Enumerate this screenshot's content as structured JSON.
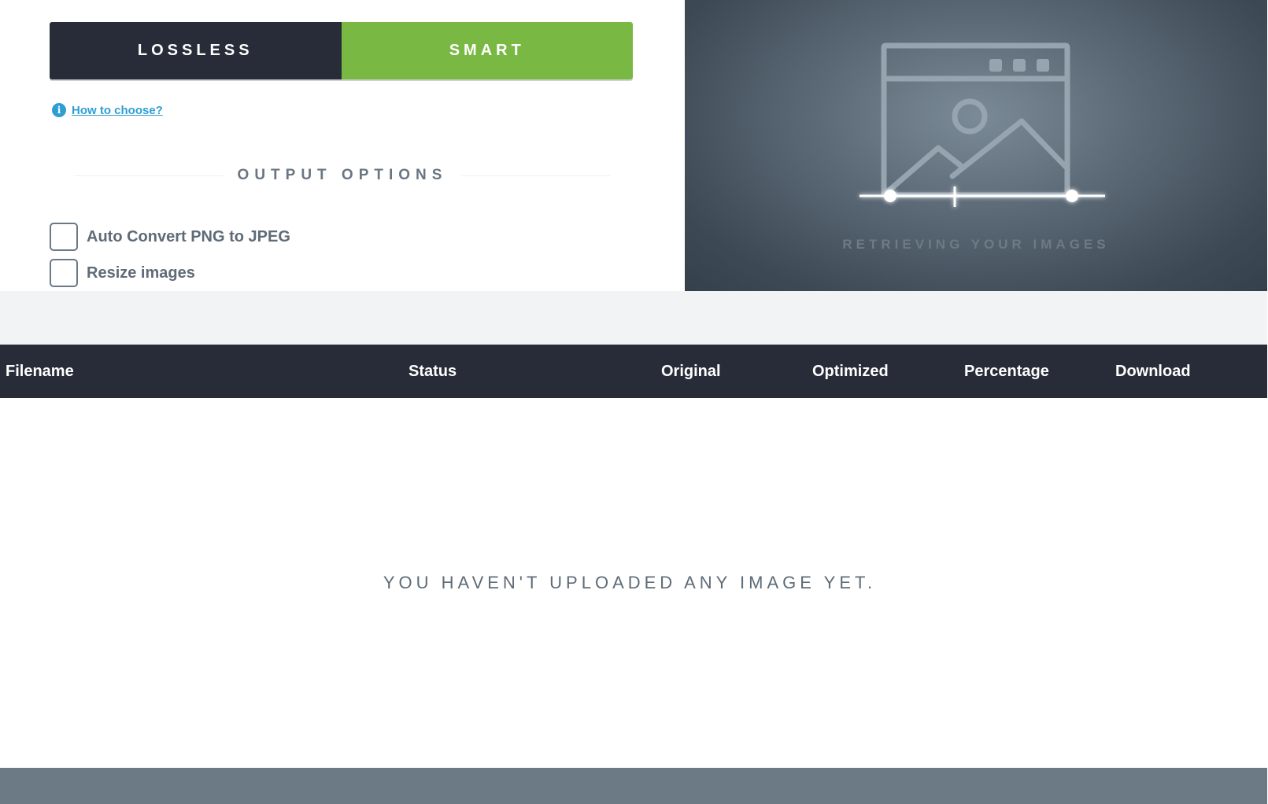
{
  "compression_modes": {
    "lossless_label": "LOSSLESS",
    "smart_label": "SMART",
    "active": "SMART",
    "active_color": "#7ab844",
    "inactive_color": "#282c39"
  },
  "help": {
    "icon": "info-icon",
    "link_text": "How to choose?"
  },
  "output_options": {
    "heading": "OUTPUT OPTIONS",
    "options": [
      {
        "label": "Auto Convert PNG to JPEG",
        "checked": false
      },
      {
        "label": "Resize images",
        "checked": false
      }
    ]
  },
  "preview": {
    "icon": "image-placeholder-icon",
    "status_text": "RETRIEVING YOUR IMAGES"
  },
  "results_table": {
    "columns": [
      "Filename",
      "Status",
      "Original",
      "Optimized",
      "Percentage",
      "Download"
    ],
    "empty_message": "YOU HAVEN'T UPLOADED ANY IMAGE YET.",
    "header_color": "#282c39"
  }
}
